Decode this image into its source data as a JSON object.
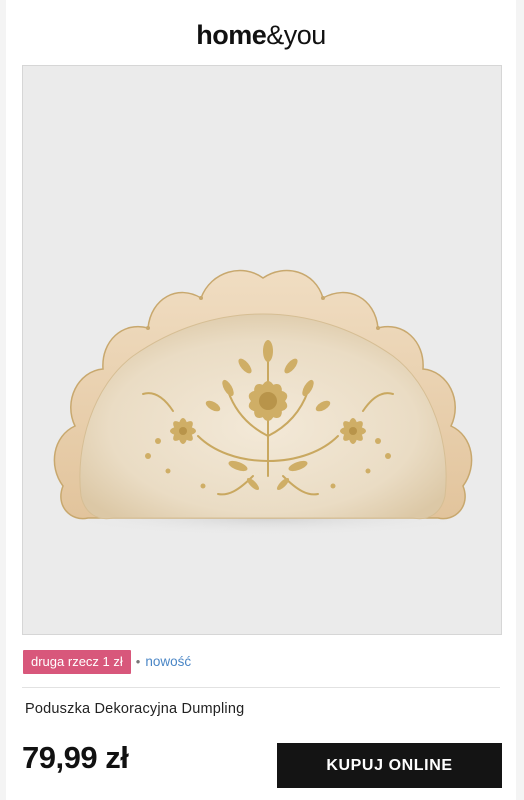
{
  "header": {
    "logo_bold": "home",
    "logo_light": "&you"
  },
  "product": {
    "image_icon": "embroidered-half-moon-pillow",
    "promo_badge": "druga rzecz 1 zł",
    "separator": "•",
    "new_tag": "nowość",
    "name": "Poduszka Dekoracyjna Dumpling",
    "price": "79,99 zł",
    "buy_label": "KUPUJ ONLINE"
  },
  "colors": {
    "badge": "#d8577b",
    "new_tag": "#4a86c6",
    "button": "#141414"
  }
}
